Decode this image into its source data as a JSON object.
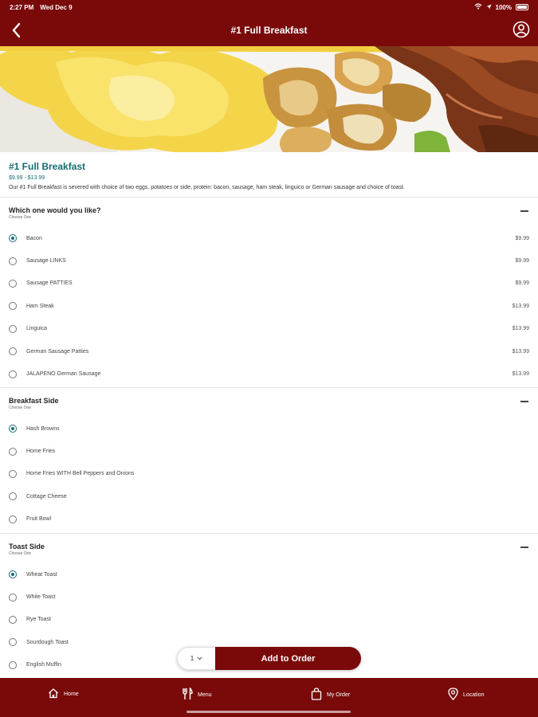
{
  "status": {
    "time": "2:27 PM",
    "date": "Wed Dec 9",
    "battery": "100%"
  },
  "nav": {
    "title": "#1 Full Breakfast"
  },
  "item": {
    "title": "#1 Full Breakfast",
    "price": "$9.99 - $13.99",
    "description": "Our #1 Full Breakfast is severed with choice of two eggs, potatoes or side, protein: bacon, sausage, ham steak, linguico or German sausage and choice of toast."
  },
  "groups": [
    {
      "title": "Which one would you like?",
      "subtitle": "Choose One",
      "options": [
        {
          "label": "Bacon",
          "price": "$9.99",
          "selected": true
        },
        {
          "label": "Sausage LINKS",
          "price": "$9.99",
          "selected": false
        },
        {
          "label": "Sausage PATTIES",
          "price": "$9.99",
          "selected": false
        },
        {
          "label": "Ham Steak",
          "price": "$13.99",
          "selected": false
        },
        {
          "label": "Linguica",
          "price": "$13.99",
          "selected": false
        },
        {
          "label": "German Sausage Patties",
          "price": "$13.99",
          "selected": false
        },
        {
          "label": "JALAPENO German Sausage",
          "price": "$13.99",
          "selected": false
        }
      ]
    },
    {
      "title": "Breakfast Side",
      "subtitle": "Choose One",
      "options": [
        {
          "label": "Hash Browns",
          "price": "",
          "selected": true
        },
        {
          "label": "Home Fries",
          "price": "",
          "selected": false
        },
        {
          "label": "Home Fries WITH Bell Peppers and Onions",
          "price": "",
          "selected": false
        },
        {
          "label": "Cottage Cheese",
          "price": "",
          "selected": false
        },
        {
          "label": "Fruit Bowl",
          "price": "",
          "selected": false
        }
      ]
    },
    {
      "title": "Toast Side",
      "subtitle": "Choose One",
      "options": [
        {
          "label": "Wheat Toast",
          "price": "",
          "selected": true
        },
        {
          "label": "White Toast",
          "price": "",
          "selected": false
        },
        {
          "label": "Rye Toast",
          "price": "",
          "selected": false
        },
        {
          "label": "Sourdough Toast",
          "price": "",
          "selected": false
        },
        {
          "label": "English Muffin",
          "price": "",
          "selected": false
        }
      ]
    }
  ],
  "order": {
    "quantity": "1",
    "add_label": "Add to Order"
  },
  "tabs": [
    {
      "label": "Home",
      "icon": "home-icon"
    },
    {
      "label": "Menu",
      "icon": "utensils-icon"
    },
    {
      "label": "My Order",
      "icon": "shopping-bag-icon"
    },
    {
      "label": "Location",
      "icon": "location-pin-icon"
    }
  ],
  "colors": {
    "brand": "#7a0a0a",
    "accent": "#176c72"
  }
}
